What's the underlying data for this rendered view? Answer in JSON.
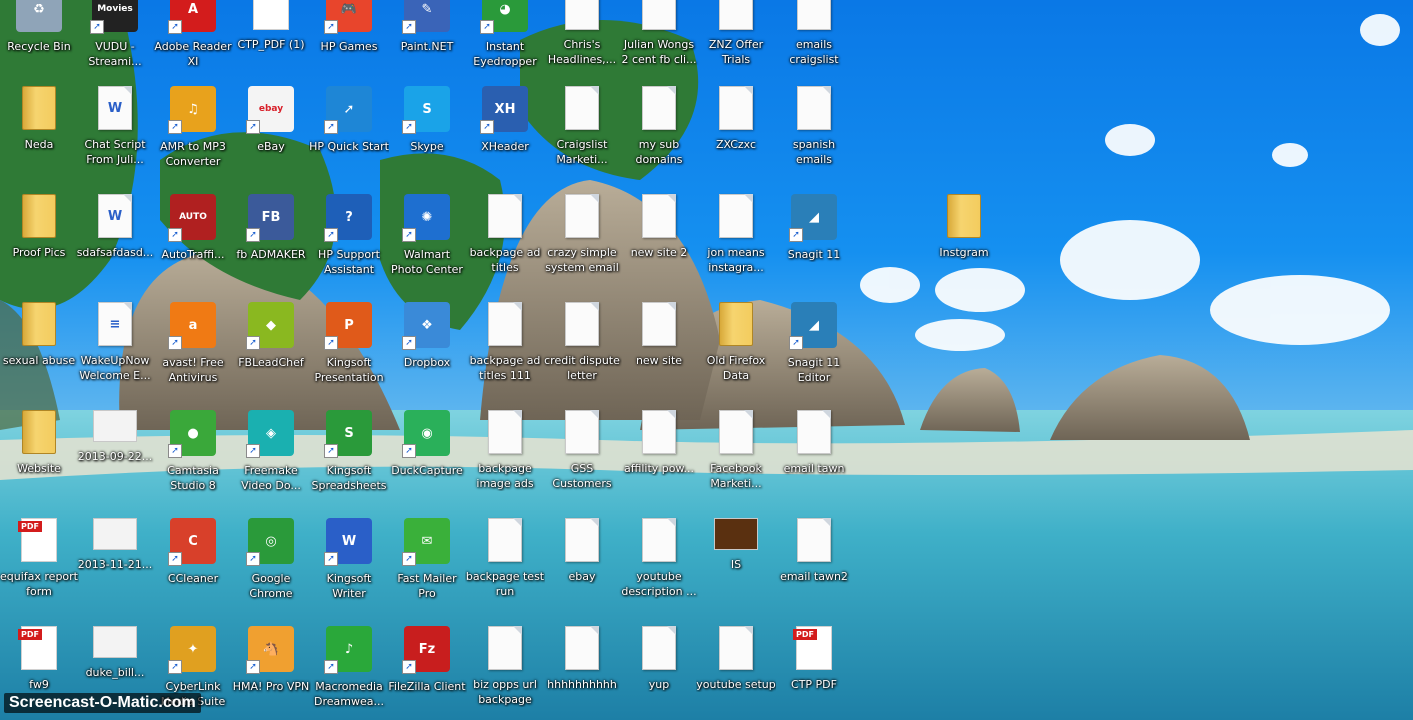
{
  "desktop": {
    "icons": [
      {
        "label": "Recycle Bin",
        "kind": "app",
        "glyph": "♻",
        "color": "#8fa4b8",
        "shortcut": false,
        "icon": "recycle-bin-icon"
      },
      {
        "label": "VUDU - Streami...",
        "kind": "app",
        "glyph": "Movies",
        "color": "#222222",
        "shortcut": true,
        "icon": "vudu-icon"
      },
      {
        "label": "Adobe Reader XI",
        "kind": "app",
        "glyph": "A",
        "color": "#d31c1c",
        "shortcut": true,
        "icon": "adobe-reader-icon"
      },
      {
        "label": "CTP_PDF (1)",
        "kind": "pdf",
        "glyph": "",
        "color": "#d31c1c",
        "shortcut": false,
        "icon": "pdf-file-icon"
      },
      {
        "label": "HP Games",
        "kind": "app",
        "glyph": "🎮",
        "color": "#e8452c",
        "shortcut": true,
        "icon": "hp-games-icon"
      },
      {
        "label": "Paint.NET",
        "kind": "app",
        "glyph": "✎",
        "color": "#3a64b8",
        "shortcut": true,
        "icon": "paint-net-icon"
      },
      {
        "label": "Instant Eyedropper",
        "kind": "app",
        "glyph": "◕",
        "color": "#2a9a3a",
        "shortcut": true,
        "icon": "eyedropper-icon"
      },
      {
        "label": "Chris's Headlines,...",
        "kind": "doc",
        "glyph": "",
        "color": "#ffffff",
        "shortcut": false,
        "icon": "document-icon"
      },
      {
        "label": "Julian Wongs 2 cent fb cli...",
        "kind": "doc",
        "glyph": "",
        "color": "#ffffff",
        "shortcut": false,
        "icon": "document-icon"
      },
      {
        "label": "ZNZ Offer Trials",
        "kind": "doc",
        "glyph": "",
        "color": "#ffffff",
        "shortcut": false,
        "icon": "document-icon"
      },
      {
        "label": "emails craigslist",
        "kind": "doc",
        "glyph": "",
        "color": "#ffffff",
        "shortcut": false,
        "icon": "document-icon"
      },
      {
        "label": "Neda",
        "kind": "folder",
        "glyph": "",
        "color": "#f3cc5e",
        "shortcut": false,
        "icon": "folder-icon"
      },
      {
        "label": "Chat Script From Juli...",
        "kind": "doc",
        "glyph": "W",
        "color": "#ffffff",
        "shortcut": false,
        "icon": "word-document-icon"
      },
      {
        "label": "AMR to MP3 Converter",
        "kind": "app",
        "glyph": "♫",
        "color": "#e8a21c",
        "shortcut": true,
        "icon": "amr-mp3-icon"
      },
      {
        "label": "eBay",
        "kind": "app",
        "glyph": "ebay",
        "color": "#f4f4f4",
        "shortcut": true,
        "icon": "ebay-icon"
      },
      {
        "label": "HP Quick Start",
        "kind": "app",
        "glyph": "➚",
        "color": "#1e86d6",
        "shortcut": true,
        "icon": "hp-quick-start-icon"
      },
      {
        "label": "Skype",
        "kind": "app",
        "glyph": "S",
        "color": "#1aa3e8",
        "shortcut": true,
        "icon": "skype-icon"
      },
      {
        "label": "XHeader",
        "kind": "app",
        "glyph": "XH",
        "color": "#2a5fb0",
        "shortcut": true,
        "icon": "xheader-icon"
      },
      {
        "label": "Craigslist Marketi...",
        "kind": "doc",
        "glyph": "",
        "color": "#ffffff",
        "shortcut": false,
        "icon": "document-icon"
      },
      {
        "label": "my sub domains",
        "kind": "doc",
        "glyph": "",
        "color": "#ffffff",
        "shortcut": false,
        "icon": "document-icon"
      },
      {
        "label": "ZXCzxc",
        "kind": "doc",
        "glyph": "",
        "color": "#ffffff",
        "shortcut": false,
        "icon": "document-icon"
      },
      {
        "label": "spanish emails",
        "kind": "doc",
        "glyph": "",
        "color": "#ffffff",
        "shortcut": false,
        "icon": "document-icon"
      },
      {
        "label": "Proof Pics",
        "kind": "folder",
        "glyph": "",
        "color": "#f3cc5e",
        "shortcut": false,
        "icon": "folder-icon"
      },
      {
        "label": "sdafsafdasd...",
        "kind": "doc",
        "glyph": "W",
        "color": "#ffffff",
        "shortcut": false,
        "icon": "word-document-icon"
      },
      {
        "label": "AutoTraffi...",
        "kind": "app",
        "glyph": "AUTO",
        "color": "#b02020",
        "shortcut": true,
        "icon": "auto-traffic-icon"
      },
      {
        "label": "fb ADMAKER",
        "kind": "app",
        "glyph": "FB",
        "color": "#3b5a9a",
        "shortcut": true,
        "icon": "fb-admaker-icon"
      },
      {
        "label": "HP Support Assistant",
        "kind": "app",
        "glyph": "?",
        "color": "#1e5fb8",
        "shortcut": true,
        "icon": "hp-support-icon"
      },
      {
        "label": "Walmart Photo Center",
        "kind": "app",
        "glyph": "✺",
        "color": "#1e6fd0",
        "shortcut": true,
        "icon": "walmart-icon"
      },
      {
        "label": "backpage ad titles",
        "kind": "doc",
        "glyph": "",
        "color": "#ffffff",
        "shortcut": false,
        "icon": "document-icon"
      },
      {
        "label": "crazy simple system email",
        "kind": "doc",
        "glyph": "",
        "color": "#ffffff",
        "shortcut": false,
        "icon": "document-icon"
      },
      {
        "label": "new site 2",
        "kind": "doc",
        "glyph": "",
        "color": "#ffffff",
        "shortcut": false,
        "icon": "document-icon"
      },
      {
        "label": "jon means instagra...",
        "kind": "doc",
        "glyph": "",
        "color": "#ffffff",
        "shortcut": false,
        "icon": "document-icon"
      },
      {
        "label": "Snagit 11",
        "kind": "app",
        "glyph": "◢",
        "color": "#2a7fb8",
        "shortcut": true,
        "icon": "snagit-icon"
      },
      {
        "label": "Instgram",
        "kind": "folder",
        "glyph": "",
        "color": "#f3cc5e",
        "shortcut": false,
        "icon": "folder-icon"
      },
      {
        "label": "sexual abuse",
        "kind": "folder",
        "glyph": "",
        "color": "#f3cc5e",
        "shortcut": false,
        "icon": "folder-icon"
      },
      {
        "label": "WakeUpNow Welcome E...",
        "kind": "doc",
        "glyph": "≡",
        "color": "#ffffff",
        "shortcut": false,
        "icon": "text-document-icon"
      },
      {
        "label": "avast! Free Antivirus",
        "kind": "app",
        "glyph": "a",
        "color": "#f07a14",
        "shortcut": true,
        "icon": "avast-icon"
      },
      {
        "label": "FBLeadChef",
        "kind": "app",
        "glyph": "◆",
        "color": "#8ab820",
        "shortcut": true,
        "icon": "fbleadchef-icon"
      },
      {
        "label": "Kingsoft Presentation",
        "kind": "app",
        "glyph": "P",
        "color": "#e05a1a",
        "shortcut": true,
        "icon": "kingsoft-presentation-icon"
      },
      {
        "label": "Dropbox",
        "kind": "app",
        "glyph": "❖",
        "color": "#3a8ad8",
        "shortcut": true,
        "icon": "dropbox-icon"
      },
      {
        "label": "backpage ad titles 111",
        "kind": "doc",
        "glyph": "",
        "color": "#ffffff",
        "shortcut": false,
        "icon": "document-icon"
      },
      {
        "label": "credit dispute letter",
        "kind": "doc",
        "glyph": "",
        "color": "#ffffff",
        "shortcut": false,
        "icon": "document-icon"
      },
      {
        "label": "new site",
        "kind": "doc",
        "glyph": "",
        "color": "#ffffff",
        "shortcut": false,
        "icon": "document-icon"
      },
      {
        "label": "Old Firefox Data",
        "kind": "folder",
        "glyph": "",
        "color": "#f3cc5e",
        "shortcut": false,
        "icon": "folder-icon"
      },
      {
        "label": "Snagit 11 Editor",
        "kind": "app",
        "glyph": "◢",
        "color": "#2a7fb8",
        "shortcut": true,
        "icon": "snagit-editor-icon"
      },
      {
        "label": "Website",
        "kind": "folder",
        "glyph": "",
        "color": "#f3cc5e",
        "shortcut": false,
        "icon": "folder-icon"
      },
      {
        "label": "2013-09-22...",
        "kind": "img",
        "glyph": "",
        "color": "#f3f3f3",
        "shortcut": false,
        "icon": "image-file-icon"
      },
      {
        "label": "Camtasia Studio 8",
        "kind": "app",
        "glyph": "●",
        "color": "#3aa83a",
        "shortcut": true,
        "icon": "camtasia-icon"
      },
      {
        "label": "Freemake Video Do...",
        "kind": "app",
        "glyph": "◈",
        "color": "#1ab0b0",
        "shortcut": true,
        "icon": "freemake-icon"
      },
      {
        "label": "Kingsoft Spreadsheets",
        "kind": "app",
        "glyph": "S",
        "color": "#2a9a3a",
        "shortcut": true,
        "icon": "kingsoft-spreadsheets-icon"
      },
      {
        "label": "DuckCapture",
        "kind": "app",
        "glyph": "◉",
        "color": "#2ab05a",
        "shortcut": true,
        "icon": "duckcapture-icon"
      },
      {
        "label": "backpage image ads",
        "kind": "doc",
        "glyph": "",
        "color": "#ffffff",
        "shortcut": false,
        "icon": "document-icon"
      },
      {
        "label": "GSS Customers",
        "kind": "doc",
        "glyph": "",
        "color": "#ffffff",
        "shortcut": false,
        "icon": "document-icon"
      },
      {
        "label": "affility pow...",
        "kind": "doc",
        "glyph": "",
        "color": "#ffffff",
        "shortcut": false,
        "icon": "document-icon"
      },
      {
        "label": "Facebook Marketi...",
        "kind": "doc",
        "glyph": "",
        "color": "#ffffff",
        "shortcut": false,
        "icon": "document-icon"
      },
      {
        "label": "email tawn",
        "kind": "doc",
        "glyph": "",
        "color": "#ffffff",
        "shortcut": false,
        "icon": "document-icon"
      },
      {
        "label": "equifax report form",
        "kind": "pdf",
        "glyph": "",
        "color": "#d31c1c",
        "shortcut": false,
        "icon": "pdf-file-icon"
      },
      {
        "label": "2013-11-21...",
        "kind": "img",
        "glyph": "",
        "color": "#f3f3f3",
        "shortcut": false,
        "icon": "image-file-icon"
      },
      {
        "label": "CCleaner",
        "kind": "app",
        "glyph": "C",
        "color": "#d8402a",
        "shortcut": true,
        "icon": "ccleaner-icon"
      },
      {
        "label": "Google Chrome",
        "kind": "app",
        "glyph": "◎",
        "color": "#2a9a3a",
        "shortcut": true,
        "icon": "chrome-icon"
      },
      {
        "label": "Kingsoft Writer",
        "kind": "app",
        "glyph": "W",
        "color": "#2a5fc8",
        "shortcut": true,
        "icon": "kingsoft-writer-icon"
      },
      {
        "label": "Fast Mailer Pro",
        "kind": "app",
        "glyph": "✉",
        "color": "#3ab03a",
        "shortcut": true,
        "icon": "fast-mailer-icon"
      },
      {
        "label": "backpage test run",
        "kind": "doc",
        "glyph": "",
        "color": "#ffffff",
        "shortcut": false,
        "icon": "document-icon"
      },
      {
        "label": "ebay",
        "kind": "doc",
        "glyph": "",
        "color": "#ffffff",
        "shortcut": false,
        "icon": "document-icon"
      },
      {
        "label": "youtube description ...",
        "kind": "doc",
        "glyph": "",
        "color": "#ffffff",
        "shortcut": false,
        "icon": "document-icon"
      },
      {
        "label": "IS",
        "kind": "img",
        "glyph": "",
        "color": "#5a3010",
        "shortcut": false,
        "icon": "image-file-icon"
      },
      {
        "label": "email tawn2",
        "kind": "doc",
        "glyph": "",
        "color": "#ffffff",
        "shortcut": false,
        "icon": "document-icon"
      },
      {
        "label": "fw9",
        "kind": "pdf",
        "glyph": "",
        "color": "#d31c1c",
        "shortcut": false,
        "icon": "pdf-file-icon"
      },
      {
        "label": "duke_bill...",
        "kind": "img",
        "glyph": "",
        "color": "#f3f3f3",
        "shortcut": false,
        "icon": "image-file-icon"
      },
      {
        "label": "CyberLink Media Suite",
        "kind": "app",
        "glyph": "✦",
        "color": "#e0a020",
        "shortcut": true,
        "icon": "cyberlink-icon"
      },
      {
        "label": "HMA! Pro VPN",
        "kind": "app",
        "glyph": "🐴",
        "color": "#f0a030",
        "shortcut": true,
        "icon": "hma-vpn-icon"
      },
      {
        "label": "Macromedia Dreamwea...",
        "kind": "app",
        "glyph": "♪",
        "color": "#2aa83a",
        "shortcut": true,
        "icon": "dreamweaver-icon"
      },
      {
        "label": "FileZilla Client",
        "kind": "app",
        "glyph": "Fz",
        "color": "#c81e1e",
        "shortcut": true,
        "icon": "filezilla-icon"
      },
      {
        "label": "biz opps url backpage",
        "kind": "doc",
        "glyph": "",
        "color": "#ffffff",
        "shortcut": false,
        "icon": "document-icon"
      },
      {
        "label": "hhhhhhhhhh",
        "kind": "doc",
        "glyph": "",
        "color": "#ffffff",
        "shortcut": false,
        "icon": "document-icon"
      },
      {
        "label": "yup",
        "kind": "doc",
        "glyph": "",
        "color": "#ffffff",
        "shortcut": false,
        "icon": "document-icon"
      },
      {
        "label": "youtube setup",
        "kind": "doc",
        "glyph": "",
        "color": "#ffffff",
        "shortcut": false,
        "icon": "document-icon"
      },
      {
        "label": "CTP PDF",
        "kind": "pdf",
        "glyph": "",
        "color": "#d31c1c",
        "shortcut": false,
        "icon": "pdf-file-icon"
      }
    ]
  },
  "watermark": {
    "text": "Screencast-O-Matic.com"
  }
}
